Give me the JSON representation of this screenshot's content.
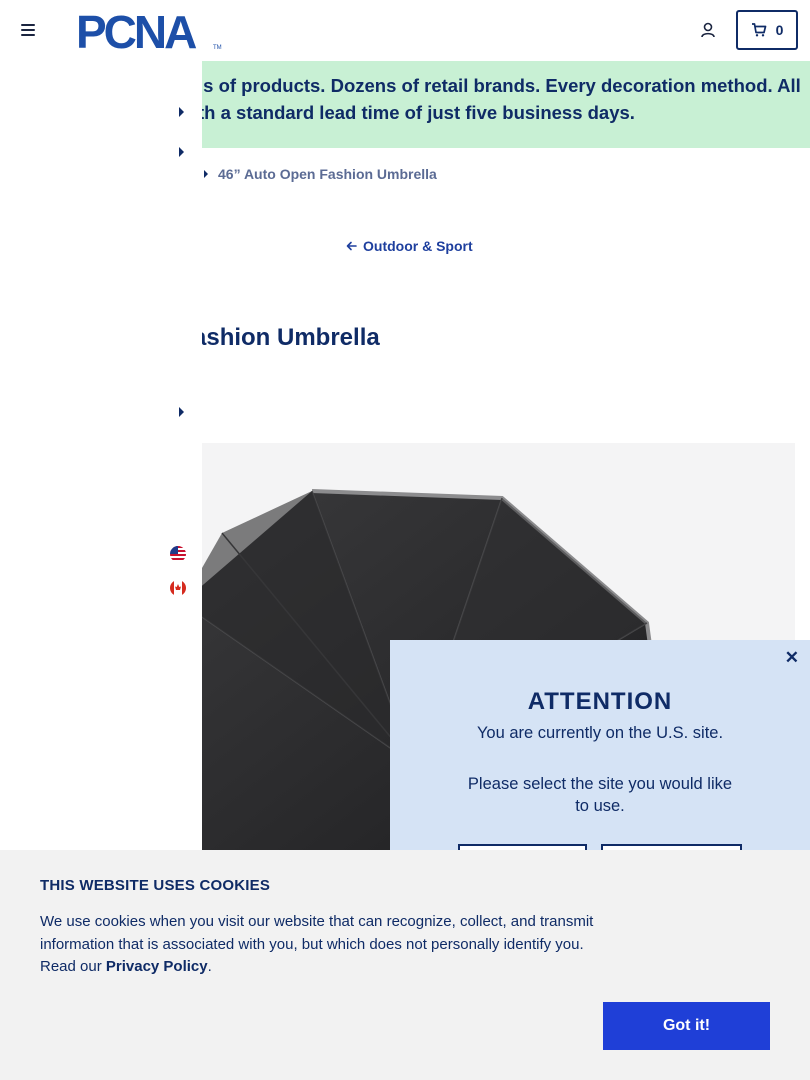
{
  "header": {
    "logo_text": "PCNA",
    "cart_count": "0"
  },
  "promo": {
    "line1": "ls of products. Dozens of retail brands. Every decoration method. All",
    "line2": "th a standard lead time of just five business days."
  },
  "breadcrumb": {
    "current": "46” Auto Open Fashion Umbrella",
    "back_label": "Outdoor & Sport"
  },
  "product": {
    "title": "ashion Umbrella"
  },
  "attention": {
    "close_label": "✕",
    "title": "ATTENTION",
    "message": "You are currently on the U.S. site.",
    "prompt": "Please select the site you would like to use."
  },
  "cookie": {
    "title": "THIS WEBSITE USES COOKIES",
    "text_before": "We use cookies when you visit our website that can recognize, collect, and transmit information that is associated with you, but which does not personally identify you. Read our ",
    "link_label": "Privacy Policy",
    "text_after": ".",
    "button_label": "Got it!"
  },
  "colors": {
    "navy": "#0f2b66",
    "promo_bg": "#c8f0d4",
    "modal_bg": "#d5e3f5",
    "button_blue": "#1f3fd7",
    "cookie_bg": "#f2f2f2"
  },
  "icons": [
    "hamburger-icon",
    "account-icon",
    "cart-icon",
    "caret-right-icon",
    "arrow-left-icon",
    "us-flag-icon",
    "canada-flag-icon",
    "close-icon"
  ]
}
